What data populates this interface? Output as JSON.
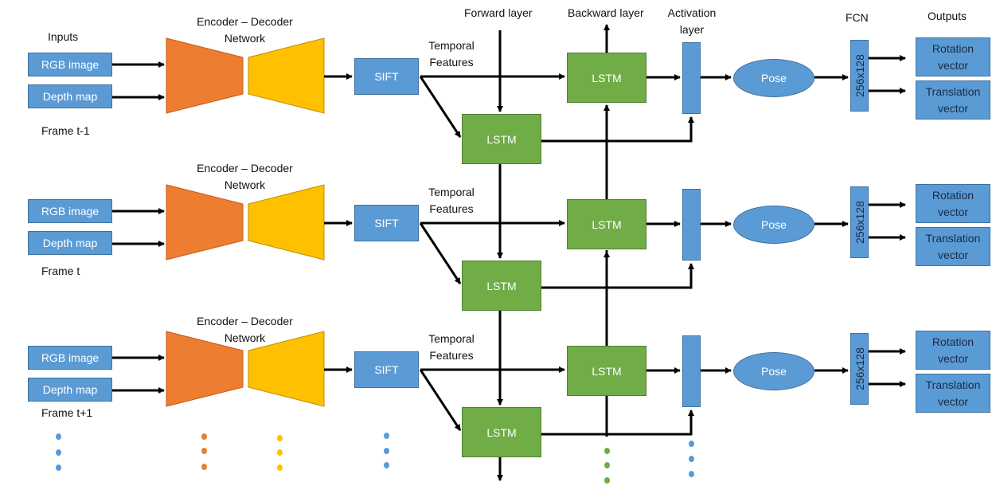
{
  "header": {
    "inputs": "Inputs",
    "forward_layer": "Forward layer",
    "backward_layer": "Backward layer",
    "activation_layer_line1": "Activation",
    "activation_layer_line2": "layer",
    "fcn": "FCN",
    "outputs": "Outputs"
  },
  "rows": [
    {
      "frame": "Frame t-1",
      "rgb": "RGB image",
      "depth": "Depth map",
      "encdec_line1": "Encoder – Decoder",
      "encdec_line2": "Network",
      "sift": "SIFT",
      "temporal_line1": "Temporal",
      "temporal_line2": "Features",
      "lstm_forward": "LSTM",
      "lstm_backward": "LSTM",
      "pose": "Pose",
      "fcn_size": "256x128",
      "rotation_line1": "Rotation",
      "rotation_line2": "vector",
      "translation_line1": "Translation",
      "translation_line2": "vector"
    },
    {
      "frame": "Frame t",
      "rgb": "RGB image",
      "depth": "Depth map",
      "encdec_line1": "Encoder – Decoder",
      "encdec_line2": "Network",
      "sift": "SIFT",
      "temporal_line1": "Temporal",
      "temporal_line2": "Features",
      "lstm_forward": "LSTM",
      "lstm_backward": "LSTM",
      "pose": "Pose",
      "fcn_size": "256x128",
      "rotation_line1": "Rotation",
      "rotation_line2": "vector",
      "translation_line1": "Translation",
      "translation_line2": "vector"
    },
    {
      "frame": "Frame t+1",
      "rgb": "RGB image",
      "depth": "Depth map",
      "encdec_line1": "Encoder – Decoder",
      "encdec_line2": "Network",
      "sift": "SIFT",
      "temporal_line1": "Temporal",
      "temporal_line2": "Features",
      "lstm_forward": "LSTM",
      "lstm_backward": "LSTM",
      "pose": "Pose",
      "fcn_size": "256x128",
      "rotation_line1": "Rotation",
      "rotation_line2": "vector",
      "translation_line1": "Translation",
      "translation_line2": "vector"
    }
  ],
  "colors": {
    "input_blue": "#5b9bd5",
    "lstm_green": "#70ad47",
    "encoder_orange": "#ed7d31",
    "decoder_yellow": "#ffc000",
    "arrow": "#000000"
  },
  "continuation": "ellipsis-dots"
}
